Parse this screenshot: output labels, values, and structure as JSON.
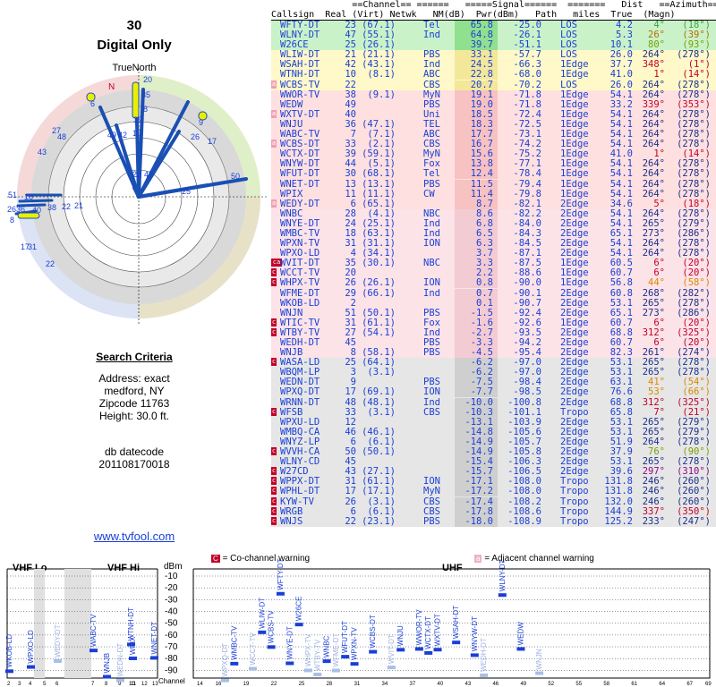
{
  "header": {
    "channel_num": "30",
    "subtitle": "Digital Only",
    "north_label": "TrueNorth",
    "north_mag": "N"
  },
  "criteria": {
    "title": "Search Criteria",
    "address": "Address: exact",
    "city": "medford, NY",
    "zip": "Zipcode 11763",
    "height": "Height: 30.0 ft.",
    "db": "db datecode",
    "dbcode": "201108170018"
  },
  "link": "www.tvfool.com",
  "table": {
    "hdr1": "               ==Channel== ======   =====Signal======  =======   Dist   ==Azimuth==",
    "hdr2": "Callsign  Real (Virt) Netwk   NM(dB)  Pwr(dBm)   Path   miles  True  (Magn)",
    "rows": [
      [
        "WFTY-DT",
        "23",
        "(67.1)",
        "Tel",
        "65.8",
        "-25.0",
        "LOS",
        "4.2",
        "4°",
        "(18°)",
        "g",
        "",
        "#3fa33f"
      ],
      [
        "WLNY-DT",
        "47",
        "(55.1)",
        "Ind",
        "64.8",
        "-26.1",
        "LOS",
        "5.3",
        "26°",
        "(39°)",
        "g",
        "",
        "#b36f00"
      ],
      [
        "W26CE",
        "25",
        "(26.1)",
        "",
        "39.7",
        "-51.1",
        "LOS",
        "10.1",
        "80°",
        "(93°)",
        "g",
        "",
        "#7a9f00"
      ],
      [
        "WLIW-DT",
        "21",
        "(21.1)",
        "PBS",
        "33.1",
        "-57.7",
        "LOS",
        "26.0",
        "264°",
        "(278°)",
        "y",
        "",
        "#1c2f8a"
      ],
      [
        "WSAH-DT",
        "42",
        "(43.1)",
        "Ind",
        "24.5",
        "-66.3",
        "1Edge",
        "37.7",
        "348°",
        "(1°)",
        "y",
        "",
        "#c2002a"
      ],
      [
        "WTNH-DT",
        "10",
        "(8.1)",
        "ABC",
        "22.8",
        "-68.0",
        "1Edge",
        "41.0",
        "1°",
        "(14°)",
        "y",
        "",
        "#c2002a"
      ],
      [
        "WCBS-TV",
        "22",
        "",
        "CBS",
        "20.7",
        "-70.2",
        "LOS",
        "26.0",
        "264°",
        "(278°)",
        "y",
        "a",
        "#1c2f8a"
      ],
      [
        "WWOR-TV",
        "38",
        "(9.1)",
        "MyN",
        "19.1",
        "-71.8",
        "1Edge",
        "54.1",
        "264°",
        "(278°)",
        "r",
        "",
        "#1c2f8a"
      ],
      [
        "WEDW",
        "49",
        "",
        "PBS",
        "19.0",
        "-71.8",
        "1Edge",
        "33.2",
        "339°",
        "(353°)",
        "r",
        "",
        "#c2002a"
      ],
      [
        "WXTV-DT",
        "40",
        "",
        "Uni",
        "18.5",
        "-72.4",
        "1Edge",
        "54.1",
        "264°",
        "(278°)",
        "r",
        "a",
        "#1c2f8a"
      ],
      [
        "WNJU",
        "36",
        "(47.1)",
        "TEL",
        "18.3",
        "-72.5",
        "1Edge",
        "54.1",
        "264°",
        "(278°)",
        "r",
        "",
        "#1c2f8a"
      ],
      [
        "WABC-TV",
        "7",
        "(7.1)",
        "ABC",
        "17.7",
        "-73.1",
        "1Edge",
        "54.1",
        "264°",
        "(278°)",
        "r",
        "",
        "#1c2f8a"
      ],
      [
        "WCBS-DT",
        "33",
        "(2.1)",
        "CBS",
        "16.7",
        "-74.2",
        "1Edge",
        "54.1",
        "264°",
        "(278°)",
        "r",
        "a",
        "#1c2f8a"
      ],
      [
        "WCTX-DT",
        "39",
        "(59.1)",
        "MyN",
        "15.6",
        "-75.2",
        "1Edge",
        "41.0",
        "1°",
        "(14°)",
        "r",
        "",
        "#c2002a"
      ],
      [
        "WNYW-DT",
        "44",
        "(5.1)",
        "Fox",
        "13.8",
        "-77.1",
        "1Edge",
        "54.1",
        "264°",
        "(278°)",
        "r",
        "",
        "#1c2f8a"
      ],
      [
        "WFUT-DT",
        "30",
        "(68.1)",
        "Tel",
        "12.4",
        "-78.4",
        "1Edge",
        "54.1",
        "264°",
        "(278°)",
        "r",
        "",
        "#1c2f8a"
      ],
      [
        "WNET-DT",
        "13",
        "(13.1)",
        "PBS",
        "11.5",
        "-79.4",
        "1Edge",
        "54.1",
        "264°",
        "(278°)",
        "r",
        "",
        "#1c2f8a"
      ],
      [
        "WPIX",
        "11",
        "(11.1)",
        "CW",
        "11.4",
        "-79.8",
        "1Edge",
        "54.1",
        "264°",
        "(278°)",
        "r",
        "",
        "#1c2f8a"
      ],
      [
        "WEDY-DT",
        "6",
        "(65.1)",
        "",
        "8.7",
        "-82.1",
        "2Edge",
        "34.6",
        "5°",
        "(18°)",
        "r",
        "a",
        "#c2002a"
      ],
      [
        "WNBC",
        "28",
        "(4.1)",
        "NBC",
        "8.6",
        "-82.2",
        "2Edge",
        "54.1",
        "264°",
        "(278°)",
        "p",
        "",
        "#1c2f8a"
      ],
      [
        "WNYE-DT",
        "24",
        "(25.1)",
        "Ind",
        "6.8",
        "-84.0",
        "2Edge",
        "54.1",
        "265°",
        "(279°)",
        "p",
        "",
        "#1c2f8a"
      ],
      [
        "WMBC-TV",
        "18",
        "(63.1)",
        "Ind",
        "6.5",
        "-84.3",
        "2Edge",
        "65.1",
        "273°",
        "(286°)",
        "p",
        "",
        "#1c2f8a"
      ],
      [
        "WPXN-TV",
        "31",
        "(31.1)",
        "ION",
        "6.3",
        "-84.5",
        "2Edge",
        "54.1",
        "264°",
        "(278°)",
        "p",
        "",
        "#1c2f8a"
      ],
      [
        "WPXO-LD",
        "4",
        "(34.1)",
        "",
        "3.7",
        "-87.1",
        "2Edge",
        "54.1",
        "264°",
        "(278°)",
        "p",
        "",
        "#1c2f8a"
      ],
      [
        "WVIT-DT",
        "35",
        "(30.1)",
        "NBC",
        "3.3",
        "-87.5",
        "1Edge",
        "60.5",
        "6°",
        "(20°)",
        "p",
        "ca",
        "#c2002a"
      ],
      [
        "WCCT-TV",
        "20",
        "",
        "",
        "2.2",
        "-88.6",
        "1Edge",
        "60.7",
        "6°",
        "(20°)",
        "p",
        "c",
        "#c2002a"
      ],
      [
        "WHPX-TV",
        "26",
        "(26.1)",
        "ION",
        "0.8",
        "-90.0",
        "1Edge",
        "56.8",
        "44°",
        "(58°)",
        "p",
        "c",
        "#d98a00"
      ],
      [
        "WFME-DT",
        "29",
        "(66.1)",
        "Ind",
        "0.7",
        "-90.1",
        "2Edge",
        "60.8",
        "268°",
        "(282°)",
        "p",
        "",
        "#1c2f8a"
      ],
      [
        "WKOB-LD",
        "2",
        "",
        "",
        "0.1",
        "-90.7",
        "2Edge",
        "53.1",
        "265°",
        "(278°)",
        "p",
        "",
        "#1c2f8a"
      ],
      [
        "WNJN",
        "51",
        "(50.1)",
        "PBS",
        "-1.5",
        "-92.4",
        "2Edge",
        "65.1",
        "273°",
        "(286°)",
        "p",
        "",
        "#1c2f8a"
      ],
      [
        "WTIC-TV",
        "31",
        "(61.1)",
        "Fox",
        "-1.6",
        "-92.6",
        "1Edge",
        "60.7",
        "6°",
        "(20°)",
        "p",
        "c",
        "#c2002a"
      ],
      [
        "WTBY-TV",
        "27",
        "(54.1)",
        "Ind",
        "-2.7",
        "-93.5",
        "2Edge",
        "68.8",
        "312°",
        "(325°)",
        "p",
        "c",
        "#c2002a"
      ],
      [
        "WEDH-DT",
        "45",
        "",
        "PBS",
        "-3.3",
        "-94.2",
        "2Edge",
        "60.7",
        "6°",
        "(20°)",
        "p",
        "",
        "#c2002a"
      ],
      [
        "WNJB",
        "8",
        "(58.1)",
        "PBS",
        "-4.5",
        "-95.4",
        "2Edge",
        "82.3",
        "261°",
        "(274°)",
        "p",
        "",
        "#1c2f8a"
      ],
      [
        "WASA-LD",
        "25",
        "(64.1)",
        "",
        "-6.2",
        "-97.0",
        "2Edge",
        "53.1",
        "265°",
        "(278°)",
        "w",
        "c",
        "#1c2f8a"
      ],
      [
        "WBQM-LP",
        "3",
        "(3.1)",
        "",
        "-6.2",
        "-97.0",
        "2Edge",
        "53.1",
        "265°",
        "(278°)",
        "w",
        "",
        "#1c2f8a"
      ],
      [
        "WEDN-DT",
        "9",
        "",
        "PBS",
        "-7.5",
        "-98.4",
        "2Edge",
        "63.1",
        "41°",
        "(54°)",
        "w",
        "",
        "#d98a00"
      ],
      [
        "WPXQ-DT",
        "17",
        "(69.1)",
        "ION",
        "-7.7",
        "-98.5",
        "2Edge",
        "76.6",
        "53°",
        "(66°)",
        "w",
        "",
        "#d98a00"
      ],
      [
        "WRNN-DT",
        "48",
        "(48.1)",
        "Ind",
        "-10.0",
        "-100.8",
        "2Edge",
        "68.8",
        "312°",
        "(325°)",
        "w",
        "",
        "#c2002a"
      ],
      [
        "WFSB",
        "33",
        "(3.1)",
        "CBS",
        "-10.3",
        "-101.1",
        "Tropo",
        "65.8",
        "7°",
        "(21°)",
        "w",
        "c",
        "#c2002a"
      ],
      [
        "WPXU-LD",
        "12",
        "",
        "",
        "-13.1",
        "-103.9",
        "2Edge",
        "53.1",
        "265°",
        "(279°)",
        "w",
        "",
        "#1c2f8a"
      ],
      [
        "WMBQ-CA",
        "46",
        "(46.1)",
        "",
        "-14.8",
        "-105.6",
        "2Edge",
        "53.1",
        "265°",
        "(279°)",
        "w",
        "",
        "#1c2f8a"
      ],
      [
        "WNYZ-LP",
        "6",
        "(6.1)",
        "",
        "-14.9",
        "-105.7",
        "2Edge",
        "51.9",
        "264°",
        "(278°)",
        "w",
        "",
        "#1c2f8a"
      ],
      [
        "WVVH-CA",
        "50",
        "(50.1)",
        "",
        "-14.9",
        "-105.8",
        "2Edge",
        "37.9",
        "76°",
        "(90°)",
        "w",
        "c",
        "#7a9f00"
      ],
      [
        "WLNY-CD",
        "45",
        "",
        "",
        "-15.4",
        "-106.3",
        "2Edge",
        "53.1",
        "265°",
        "(278°)",
        "w",
        "",
        "#1c2f8a"
      ],
      [
        "W27CD",
        "43",
        "(27.1)",
        "",
        "-15.7",
        "-106.5",
        "2Edge",
        "39.6",
        "297°",
        "(310°)",
        "w",
        "c",
        "#8a0a8a"
      ],
      [
        "WPPX-DT",
        "31",
        "(61.1)",
        "ION",
        "-17.1",
        "-108.0",
        "Tropo",
        "131.8",
        "246°",
        "(260°)",
        "w",
        "c",
        "#1c2f8a"
      ],
      [
        "WPHL-DT",
        "17",
        "(17.1)",
        "MyN",
        "-17.2",
        "-108.0",
        "Tropo",
        "131.8",
        "246°",
        "(260°)",
        "w",
        "c",
        "#1c2f8a"
      ],
      [
        "KYW-TV",
        "26",
        "(3.1)",
        "CBS",
        "-17.4",
        "-108.2",
        "Tropo",
        "132.0",
        "246°",
        "(260°)",
        "w",
        "c",
        "#1c2f8a"
      ],
      [
        "WRGB",
        "6",
        "(6.1)",
        "CBS",
        "-17.8",
        "-108.6",
        "Tropo",
        "144.9",
        "337°",
        "(350°)",
        "w",
        "c",
        "#c2002a"
      ],
      [
        "WNJS",
        "22",
        "(23.1)",
        "PBS",
        "-18.0",
        "-108.9",
        "Tropo",
        "125.2",
        "233°",
        "(247°)",
        "w",
        "c",
        "#1c2f8a"
      ]
    ]
  },
  "radar": {
    "labels": [
      "20",
      "35",
      "6",
      "39",
      "8",
      "49",
      "42",
      "10",
      "9",
      "26",
      "17",
      "48",
      "27",
      "43",
      "23",
      "47",
      "25",
      "50",
      "51",
      "18",
      "2636",
      "40",
      "38",
      "22",
      "21",
      "8",
      "17",
      "31",
      "22"
    ]
  },
  "legend": {
    "vhf_lo": "VHF Lo",
    "vhf_hi": "VHF Hi",
    "uhf": "UHF",
    "dbm": "dBm",
    "channel": "Channel",
    "cochannel_key": "C",
    "cochannel": "= Co-channel warning",
    "adjacent_key": "a",
    "adjacent": "= Adjacent channel warning",
    "dbm_ticks": [
      "-10",
      "-20",
      "-30",
      "-40",
      "-50",
      "-60",
      "-70",
      "-80",
      "-90"
    ]
  },
  "spectrum": {
    "vhf_lo_channels": [
      "2",
      "3",
      "4",
      "5",
      "6"
    ],
    "vhf_hi_channels": [
      "7",
      "8",
      "9",
      "10",
      "11",
      "12",
      "13"
    ],
    "uhf_ticks": [
      "14",
      "16",
      "19",
      "22",
      "25",
      "28",
      "31",
      "34",
      "37",
      "40",
      "43",
      "46",
      "49",
      "52",
      "55",
      "58",
      "61",
      "64",
      "67",
      "69"
    ],
    "stations_vhf": [
      {
        "name": "WKOB-LD",
        "ch": 2,
        "pwr": -90.7,
        "dim": false
      },
      {
        "name": "WPXO-LD",
        "ch": 4,
        "pwr": -87.1,
        "dim": false
      },
      {
        "name": "WEDY-DT",
        "ch": 6,
        "pwr": -82.1,
        "dim": true
      },
      {
        "name": "WABC-TV",
        "ch": 7,
        "pwr": -73.1,
        "dim": false
      },
      {
        "name": "WNJB",
        "ch": 8,
        "pwr": -95.4,
        "dim": false
      },
      {
        "name": "WEDN-DT",
        "ch": 9,
        "pwr": -98.4,
        "dim": true
      },
      {
        "name": "WTNH-DT",
        "ch": 10,
        "pwr": -68.0,
        "dim": false
      },
      {
        "name": "WPIX",
        "ch": 11,
        "pwr": -79.8,
        "dim": false
      },
      {
        "name": "WNET-DT",
        "ch": 13,
        "pwr": -79.4,
        "dim": false
      }
    ],
    "stations_uhf": [
      {
        "name": "WPXQ-DT",
        "ch": 17,
        "pwr": -98.5,
        "dim": true
      },
      {
        "name": "WMBC-TV",
        "ch": 18,
        "pwr": -84.3,
        "dim": false
      },
      {
        "name": "WCCT-TV",
        "ch": 20,
        "pwr": -88.6,
        "dim": true
      },
      {
        "name": "WLIW-DT",
        "ch": 21,
        "pwr": -57.7,
        "dim": false
      },
      {
        "name": "WCBS-TV",
        "ch": 22,
        "pwr": -70.2,
        "dim": false
      },
      {
        "name": "WFTY-DT",
        "ch": 23,
        "pwr": -25.0,
        "dim": false
      },
      {
        "name": "WNYE-DT",
        "ch": 24,
        "pwr": -84.0,
        "dim": false
      },
      {
        "name": "W26CE",
        "ch": 25,
        "pwr": -51.1,
        "dim": false
      },
      {
        "name": "WHPX-TV",
        "ch": 26,
        "pwr": -90.0,
        "dim": true
      },
      {
        "name": "WTBY-TV",
        "ch": 27,
        "pwr": -93.5,
        "dim": true
      },
      {
        "name": "WNBC",
        "ch": 28,
        "pwr": -82.2,
        "dim": false
      },
      {
        "name": "WFME-DT",
        "ch": 29,
        "pwr": -90.1,
        "dim": true
      },
      {
        "name": "WFUT-DT",
        "ch": 30,
        "pwr": -78.4,
        "dim": false
      },
      {
        "name": "WPXN-TV",
        "ch": 31,
        "pwr": -84.5,
        "dim": false
      },
      {
        "name": "WCBS-DT",
        "ch": 33,
        "pwr": -74.2,
        "dim": false
      },
      {
        "name": "WVIT-DT",
        "ch": 35,
        "pwr": -87.5,
        "dim": true
      },
      {
        "name": "WNJU",
        "ch": 36,
        "pwr": -72.5,
        "dim": false
      },
      {
        "name": "WWOR-TV",
        "ch": 38,
        "pwr": -71.8,
        "dim": false
      },
      {
        "name": "WCTX-DT",
        "ch": 39,
        "pwr": -75.2,
        "dim": false
      },
      {
        "name": "WXTV-DT",
        "ch": 40,
        "pwr": -72.4,
        "dim": false
      },
      {
        "name": "WSAH-DT",
        "ch": 42,
        "pwr": -66.3,
        "dim": false
      },
      {
        "name": "WNYW-DT",
        "ch": 44,
        "pwr": -77.1,
        "dim": false
      },
      {
        "name": "WEDH-DT",
        "ch": 45,
        "pwr": -94.2,
        "dim": true
      },
      {
        "name": "WLNY-DT",
        "ch": 47,
        "pwr": -26.1,
        "dim": false
      },
      {
        "name": "WEDW",
        "ch": 49,
        "pwr": -71.8,
        "dim": false
      },
      {
        "name": "WNJN",
        "ch": 51,
        "pwr": -92.4,
        "dim": true
      }
    ]
  }
}
